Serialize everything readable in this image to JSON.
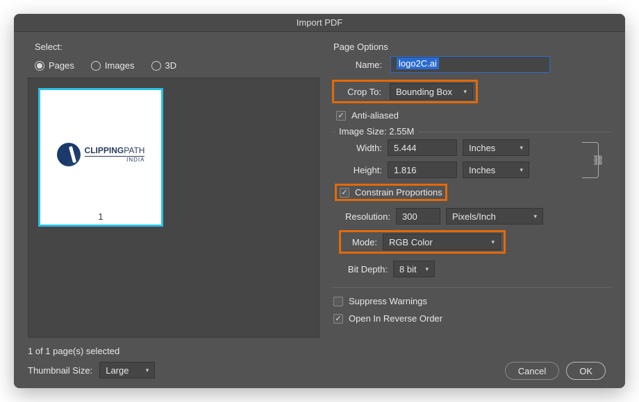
{
  "dialog": {
    "title": "Import PDF"
  },
  "left": {
    "select_label": "Select:",
    "radios": {
      "pages": "Pages",
      "images": "Images",
      "threeD": "3D",
      "selected": "pages"
    },
    "thumb": {
      "page_number": "1"
    },
    "selection_info": "1 of 1 page(s) selected",
    "thumbnail_size_label": "Thumbnail Size:",
    "thumbnail_size_value": "Large"
  },
  "page_options": {
    "group_label": "Page Options",
    "name_label": "Name:",
    "name_value": "logo2C.ai",
    "crop_label": "Crop To:",
    "crop_value": "Bounding Box",
    "antialiased_label": "Anti-aliased",
    "antialiased_checked": true
  },
  "image_size": {
    "group_label": "Image Size: 2.55M",
    "width_label": "Width:",
    "width_value": "5.444",
    "width_unit": "Inches",
    "height_label": "Height:",
    "height_value": "1.816",
    "height_unit": "Inches",
    "constrain_label": "Constrain Proportions",
    "constrain_checked": true,
    "resolution_label": "Resolution:",
    "resolution_value": "300",
    "resolution_unit": "Pixels/Inch",
    "mode_label": "Mode:",
    "mode_value": "RGB Color",
    "bitdepth_label": "Bit Depth:",
    "bitdepth_value": "8 bit"
  },
  "bottom": {
    "suppress_label": "Suppress Warnings",
    "suppress_checked": false,
    "reverse_label": "Open In Reverse Order",
    "reverse_checked": true
  },
  "buttons": {
    "cancel": "Cancel",
    "ok": "OK"
  }
}
